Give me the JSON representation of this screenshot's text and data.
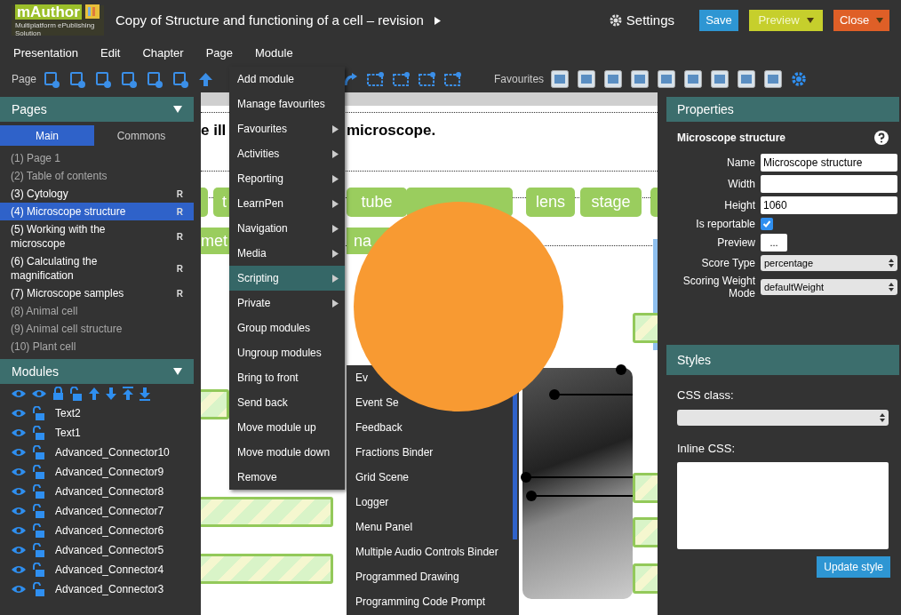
{
  "header": {
    "logo": {
      "name": "mAuthor",
      "tagline": "Multiplatform ePublishing Solution"
    },
    "title": "Copy of Structure and functioning of a cell – revision",
    "settings": "Settings",
    "buttons": [
      {
        "label": "Save",
        "kind": "plain"
      },
      {
        "label": "Preview",
        "kind": "split"
      },
      {
        "label": "Close",
        "kind": "split"
      }
    ]
  },
  "menubar": [
    {
      "label": "Presentation"
    },
    {
      "label": "Edit"
    },
    {
      "label": "Chapter"
    },
    {
      "label": "Page"
    },
    {
      "label": "Module"
    }
  ],
  "toolbar": {
    "page_label": "Page",
    "favourites_label": "Favourites"
  },
  "module_menu": [
    {
      "label": "Add module",
      "submenu": false,
      "selected": false
    },
    {
      "label": "Manage favourites",
      "submenu": false,
      "selected": false
    },
    {
      "label": "Favourites",
      "submenu": true,
      "selected": false
    },
    {
      "label": "Activities",
      "submenu": true,
      "selected": false
    },
    {
      "label": "Reporting",
      "submenu": true,
      "selected": false
    },
    {
      "label": "LearnPen",
      "submenu": true,
      "selected": false
    },
    {
      "label": "Navigation",
      "submenu": true,
      "selected": false
    },
    {
      "label": "Media",
      "submenu": true,
      "selected": false
    },
    {
      "label": "Scripting",
      "submenu": true,
      "selected": true
    },
    {
      "label": "Private",
      "submenu": true,
      "selected": false
    },
    {
      "label": "Group modules",
      "submenu": false,
      "selected": false
    },
    {
      "label": "Ungroup modules",
      "submenu": false,
      "selected": false
    },
    {
      "label": "Bring to front",
      "submenu": false,
      "selected": false
    },
    {
      "label": "Send back",
      "submenu": false,
      "selected": false
    },
    {
      "label": "Move module up",
      "submenu": false,
      "selected": false
    },
    {
      "label": "Move module down",
      "submenu": false,
      "selected": false
    },
    {
      "label": "Remove",
      "submenu": false,
      "selected": false
    }
  ],
  "scripting_submenu": [
    "Ev",
    "Event Se",
    "Feedback",
    "Fractions Binder",
    "Grid Scene",
    "Logger",
    "Menu Panel",
    "Multiple Audio Controls Binder",
    "Programmed Drawing",
    "Programming Code Prompt"
  ],
  "pages_panel": {
    "title": "Pages",
    "tabs": [
      {
        "label": "Main",
        "selected": true
      },
      {
        "label": "Commons",
        "selected": false
      }
    ],
    "pages": [
      {
        "label": "(1) Page 1",
        "reportable": false,
        "selected": false
      },
      {
        "label": "(2) Table of contents",
        "reportable": false,
        "selected": false
      },
      {
        "label": "(3) Cytology",
        "reportable": true,
        "mark": "R",
        "selected": false
      },
      {
        "label": "(4) Microscope structure",
        "reportable": true,
        "mark": "R",
        "selected": true
      },
      {
        "label": "(5) Working with the microscope",
        "reportable": true,
        "mark": "R",
        "selected": false
      },
      {
        "label": "(6) Calculating the magnification",
        "reportable": true,
        "mark": "R",
        "selected": false
      },
      {
        "label": "(7) Microscope samples",
        "reportable": true,
        "mark": "R",
        "selected": false
      },
      {
        "label": "(8) Animal cell",
        "reportable": false,
        "selected": false
      },
      {
        "label": "(9) Animal cell structure",
        "reportable": false,
        "selected": false
      },
      {
        "label": "(10) Plant cell",
        "reportable": false,
        "selected": false
      }
    ]
  },
  "modules_panel": {
    "title": "Modules",
    "modules": [
      "Text2",
      "Text1",
      "Advanced_Connector10",
      "Advanced_Connector9",
      "Advanced_Connector8",
      "Advanced_Connector7",
      "Advanced_Connector6",
      "Advanced_Connector5",
      "Advanced_Connector4",
      "Advanced_Connector3"
    ]
  },
  "canvas": {
    "heading_start": "e ill",
    "heading_end": "microscope.",
    "tags": [
      "t",
      "tube",
      "lens",
      "stage"
    ],
    "tags_row2": [
      "met",
      "na"
    ]
  },
  "properties": {
    "title": "Properties",
    "module_name": "Microscope structure",
    "fields": [
      {
        "kind": "text",
        "label": "Name",
        "value": "Microscope structure"
      },
      {
        "kind": "text",
        "label": "Width"
      },
      {
        "kind": "text",
        "label": "Height",
        "value": "1060"
      },
      {
        "kind": "checkbox",
        "label": "Is reportable",
        "checked": true
      },
      {
        "kind": "button",
        "label": "Preview",
        "value": "..."
      },
      {
        "kind": "select",
        "label": "Score Type",
        "value": "percentage"
      },
      {
        "kind": "select",
        "label": "Scoring Weight Mode",
        "value": "defaultWeight"
      }
    ]
  },
  "styles": {
    "title": "Styles",
    "css_class_label": "CSS class:",
    "inline_css_label": "Inline CSS:",
    "button": "Update style"
  }
}
